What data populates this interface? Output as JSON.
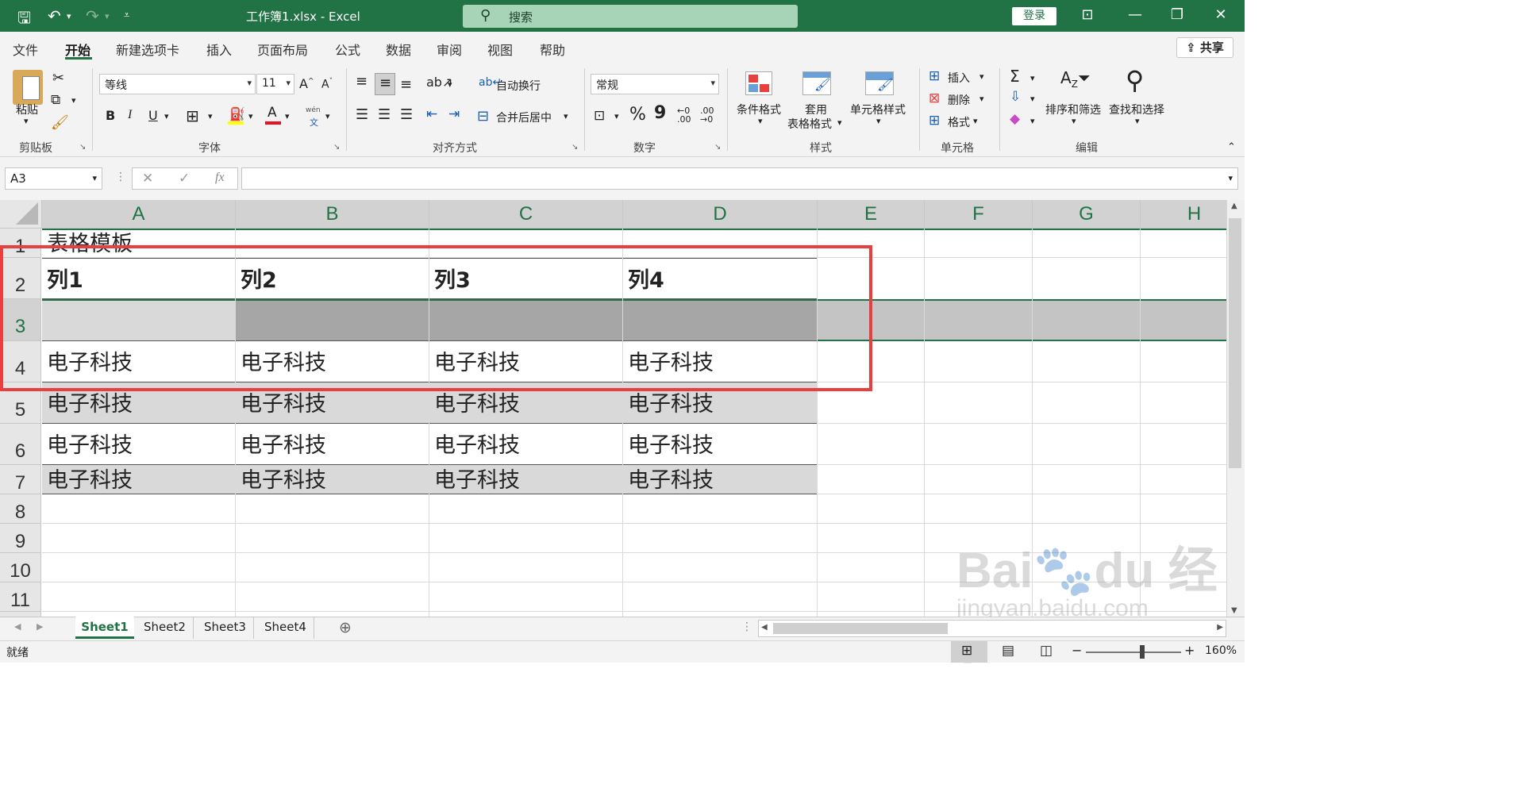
{
  "titlebar": {
    "doc_title": "工作簿1.xlsx  -  Excel",
    "search_placeholder": "搜索",
    "login": "登录"
  },
  "tabs": [
    "文件",
    "开始",
    "新建选项卡",
    "插入",
    "页面布局",
    "公式",
    "数据",
    "审阅",
    "视图",
    "帮助"
  ],
  "share": "共享",
  "ribbon": {
    "clipboard": {
      "paste": "粘贴",
      "label": "剪贴板"
    },
    "font": {
      "name": "等线",
      "size": "11",
      "label": "字体",
      "bold": "B",
      "italic": "I",
      "underline": "U",
      "wen": "wén"
    },
    "align": {
      "wrap": "自动换行",
      "merge": "合并后居中",
      "label": "对齐方式"
    },
    "number": {
      "format": "常规",
      "percent": "%",
      "comma": "9",
      "label": "数字"
    },
    "styles": {
      "cond": "条件格式",
      "table1": "套用",
      "table2": "表格格式",
      "cellstyle": "单元格样式",
      "label": "样式"
    },
    "cells": {
      "insert": "插入",
      "delete": "删除",
      "format": "格式",
      "label": "单元格"
    },
    "edit": {
      "sort": "排序和筛选",
      "find": "查找和选择",
      "label": "编辑"
    }
  },
  "namebox": "A3",
  "columns": [
    "A",
    "B",
    "C",
    "D",
    "E",
    "F",
    "G",
    "H"
  ],
  "rows": [
    "1",
    "2",
    "3",
    "4",
    "5",
    "6",
    "7",
    "8",
    "9",
    "10",
    "11"
  ],
  "cells": {
    "a1": "表格模板",
    "header": [
      "列1",
      "列2",
      "列3",
      "列4"
    ],
    "row4": [
      "电子科技",
      "电子科技",
      "电子科技",
      "电子科技"
    ],
    "row5": [
      "电子科技",
      "电子科技",
      "电子科技",
      "电子科技"
    ],
    "row6": [
      "电子科技",
      "电子科技",
      "电子科技",
      "电子科技"
    ],
    "row7": [
      "电子科技",
      "电子科技",
      "电子科技",
      "电子科技"
    ]
  },
  "sheets": [
    "Sheet1",
    "Sheet2",
    "Sheet3",
    "Sheet4"
  ],
  "status": {
    "ready": "就绪",
    "zoom": "160%"
  },
  "colors": {
    "brand": "#217346",
    "highlight": "#e8403f"
  }
}
